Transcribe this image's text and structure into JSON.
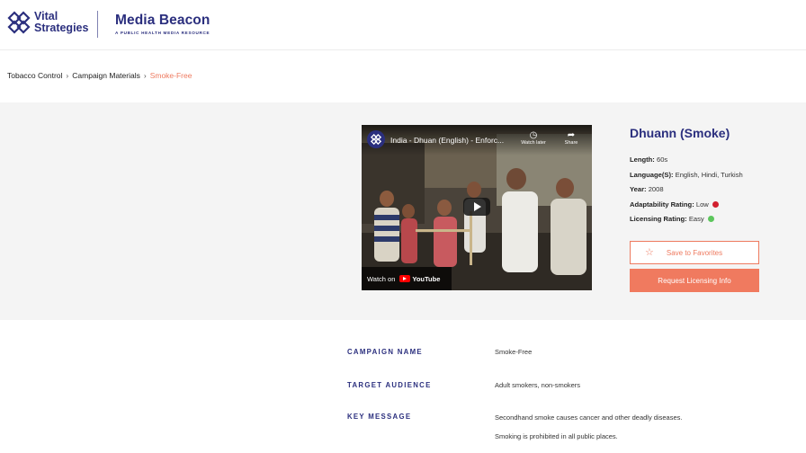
{
  "header": {
    "vs_line1": "Vital",
    "vs_line2": "Strategies",
    "mb_title": "Media Beacon",
    "mb_subtitle": "A PUBLIC HEALTH MEDIA RESOURCE",
    "brand_color": "#2b2f7e"
  },
  "breadcrumb": {
    "items": [
      "Tobacco Control",
      "Campaign Materials"
    ],
    "separator": "›",
    "current": "Smoke-Free"
  },
  "video": {
    "title": "India - Dhuan (English) - Enforc...",
    "watch_later": "Watch later",
    "share": "Share",
    "watch_on": "Watch on",
    "youtube": "YouTube"
  },
  "details": {
    "title": "Dhuann (Smoke)",
    "length_label": "Length:",
    "length_value": "60s",
    "language_label": "Language(S):",
    "language_value": "English, Hindi, Turkish",
    "year_label": "Year:",
    "year_value": "2008",
    "adapt_label": "Adaptability Rating:",
    "adapt_value": "Low",
    "adapt_color": "#d2202f",
    "licensing_label": "Licensing Rating:",
    "licensing_value": "Easy",
    "licensing_color": "#5cc65c"
  },
  "actions": {
    "favorites": "Save to Favorites",
    "licensing": "Request Licensing Info",
    "accent_color": "#ee7a5f"
  },
  "info": {
    "campaign_name_label": "CAMPAIGN NAME",
    "campaign_name_value": "Smoke-Free",
    "target_audience_label": "TARGET AUDIENCE",
    "target_audience_value": "Adult smokers, non-smokers",
    "key_message_label": "KEY MESSAGE",
    "key_message_line1": "Secondhand smoke causes cancer and other deadly diseases.",
    "key_message_line2": "Smoking is prohibited in all public places."
  }
}
